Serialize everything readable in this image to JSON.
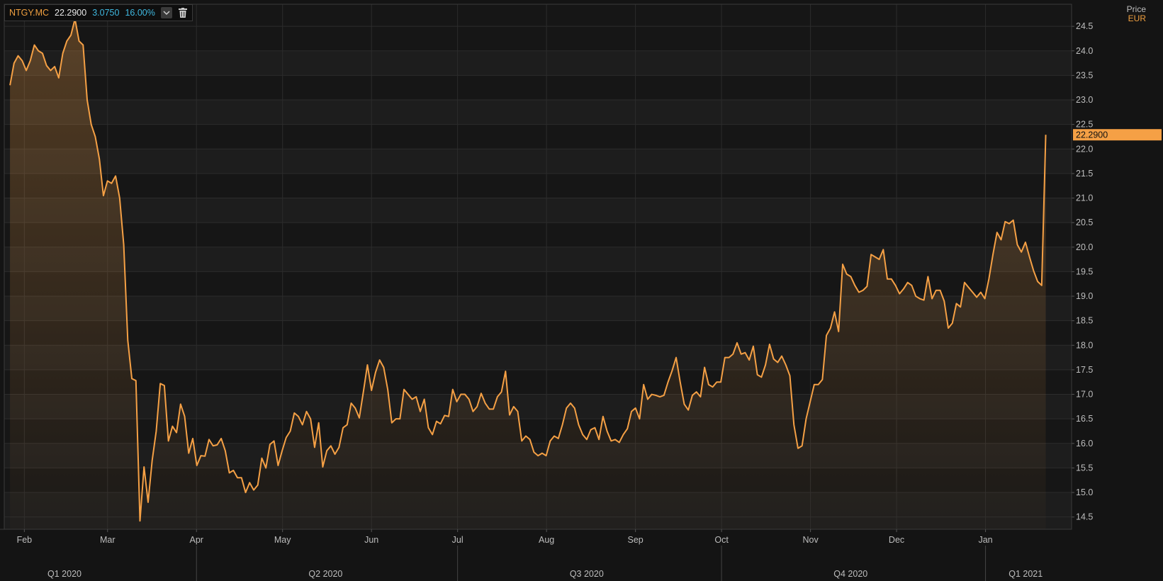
{
  "legend": {
    "symbol": "NTGY.MC",
    "price": "22.2900",
    "change": "3.0750",
    "change_pct": "16.00%",
    "menu_icon": "chevron-down-icon",
    "delete_icon": "trash-icon"
  },
  "y_axis": {
    "title": "Price",
    "currency": "EUR"
  },
  "colors": {
    "background": "#141414",
    "band_dark": "#161616",
    "band_light": "#1d1d1d",
    "line": "#f5a045",
    "change": "#3fb8e0",
    "last_price_tag": "#f5a045"
  },
  "chart_data": {
    "type": "area",
    "series": [
      {
        "name": "NTGY.MC",
        "x_range": [
          "2020-01-27",
          "2021-01-22"
        ],
        "values": [
          23.3,
          23.75,
          23.9,
          23.8,
          23.6,
          23.8,
          24.12,
          24.0,
          23.95,
          23.7,
          23.6,
          23.68,
          23.45,
          23.95,
          24.2,
          24.32,
          24.65,
          24.2,
          24.12,
          23.0,
          22.5,
          22.25,
          21.8,
          21.05,
          21.35,
          21.3,
          21.45,
          21.0,
          20.05,
          18.1,
          17.32,
          17.28,
          14.42,
          15.52,
          14.8,
          15.65,
          16.25,
          17.22,
          17.18,
          16.05,
          16.35,
          16.22,
          16.8,
          16.55,
          15.8,
          16.1,
          15.55,
          15.75,
          15.74,
          16.08,
          15.95,
          15.97,
          16.1,
          15.85,
          15.4,
          15.45,
          15.3,
          15.3,
          15.0,
          15.2,
          15.05,
          15.15,
          15.7,
          15.5,
          15.98,
          16.05,
          15.55,
          15.85,
          16.12,
          16.25,
          16.62,
          16.55,
          16.38,
          16.65,
          16.5,
          15.92,
          16.42,
          15.52,
          15.85,
          15.95,
          15.78,
          15.92,
          16.32,
          16.38,
          16.82,
          16.72,
          16.52,
          17.05,
          17.6,
          17.08,
          17.45,
          17.7,
          17.55,
          17.1,
          16.42,
          16.5,
          16.5,
          17.1,
          17.0,
          16.9,
          16.95,
          16.65,
          16.9,
          16.32,
          16.18,
          16.45,
          16.4,
          16.57,
          16.55,
          17.1,
          16.85,
          17.0,
          17.0,
          16.9,
          16.65,
          16.75,
          17.02,
          16.82,
          16.7,
          16.7,
          16.95,
          17.05,
          17.47,
          16.58,
          16.75,
          16.65,
          16.05,
          16.15,
          16.08,
          15.82,
          15.75,
          15.8,
          15.75,
          16.05,
          16.15,
          16.1,
          16.38,
          16.72,
          16.82,
          16.72,
          16.38,
          16.18,
          16.08,
          16.28,
          16.32,
          16.08,
          16.55,
          16.25,
          16.05,
          16.08,
          16.02,
          16.18,
          16.3,
          16.65,
          16.72,
          16.5,
          17.2,
          16.9,
          17.0,
          16.98,
          16.95,
          16.98,
          17.25,
          17.48,
          17.75,
          17.25,
          16.8,
          16.68,
          16.98,
          17.05,
          16.95,
          17.55,
          17.2,
          17.15,
          17.25,
          17.25,
          17.75,
          17.75,
          17.82,
          18.05,
          17.82,
          17.85,
          17.7,
          17.98,
          17.4,
          17.35,
          17.6,
          18.02,
          17.72,
          17.65,
          17.78,
          17.6,
          17.38,
          16.38,
          15.9,
          15.95,
          16.5,
          16.85,
          17.2,
          17.2,
          17.3,
          18.2,
          18.35,
          18.68,
          18.28,
          19.65,
          19.45,
          19.4,
          19.22,
          19.08,
          19.12,
          19.2,
          19.85,
          19.8,
          19.75,
          19.95,
          19.35,
          19.35,
          19.22,
          19.05,
          19.15,
          19.28,
          19.22,
          19.0,
          18.95,
          18.92,
          19.4,
          18.95,
          19.12,
          19.12,
          18.9,
          18.35,
          18.45,
          18.85,
          18.78,
          19.28,
          19.18,
          19.08,
          18.98,
          19.08,
          18.95,
          19.35,
          19.85,
          20.3,
          20.15,
          20.52,
          20.48,
          20.55,
          20.05,
          19.9,
          20.1,
          19.8,
          19.52,
          19.3,
          19.22,
          22.29
        ]
      }
    ],
    "y_ticks": [
      "14.5",
      "15.0",
      "15.5",
      "16.0",
      "16.5",
      "17.0",
      "17.5",
      "18.0",
      "18.5",
      "19.0",
      "19.5",
      "20.0",
      "20.5",
      "21.0",
      "21.5",
      "22.0",
      "22.5",
      "23.0",
      "23.5",
      "24.0",
      "24.5"
    ],
    "ylim": [
      14.25,
      24.95
    ],
    "x_month_ticks": [
      {
        "label": "Feb",
        "date": "2020-02-01"
      },
      {
        "label": "Mar",
        "date": "2020-03-01"
      },
      {
        "label": "Apr",
        "date": "2020-04-01"
      },
      {
        "label": "May",
        "date": "2020-05-01"
      },
      {
        "label": "Jun",
        "date": "2020-06-01"
      },
      {
        "label": "Jul",
        "date": "2020-07-01"
      },
      {
        "label": "Aug",
        "date": "2020-08-01"
      },
      {
        "label": "Sep",
        "date": "2020-09-01"
      },
      {
        "label": "Oct",
        "date": "2020-10-01"
      },
      {
        "label": "Nov",
        "date": "2020-11-01"
      },
      {
        "label": "Dec",
        "date": "2020-12-01"
      },
      {
        "label": "Jan",
        "date": "2021-01-01"
      }
    ],
    "x_quarter_labels": [
      {
        "label": "Q1 2020",
        "date": "2020-02-15"
      },
      {
        "label": "Q2 2020",
        "date": "2020-05-16"
      },
      {
        "label": "Q3 2020",
        "date": "2020-08-15"
      },
      {
        "label": "Q4 2020",
        "date": "2020-11-15"
      },
      {
        "label": "Q1 2021",
        "date": "2021-01-15"
      }
    ],
    "x_quarter_dividers": [
      "2020-04-01",
      "2020-07-01",
      "2020-10-01",
      "2021-01-01"
    ],
    "last_value_label": "22.2900",
    "grid": true,
    "x_range_dates": [
      "2020-01-25",
      "2021-01-31"
    ]
  }
}
